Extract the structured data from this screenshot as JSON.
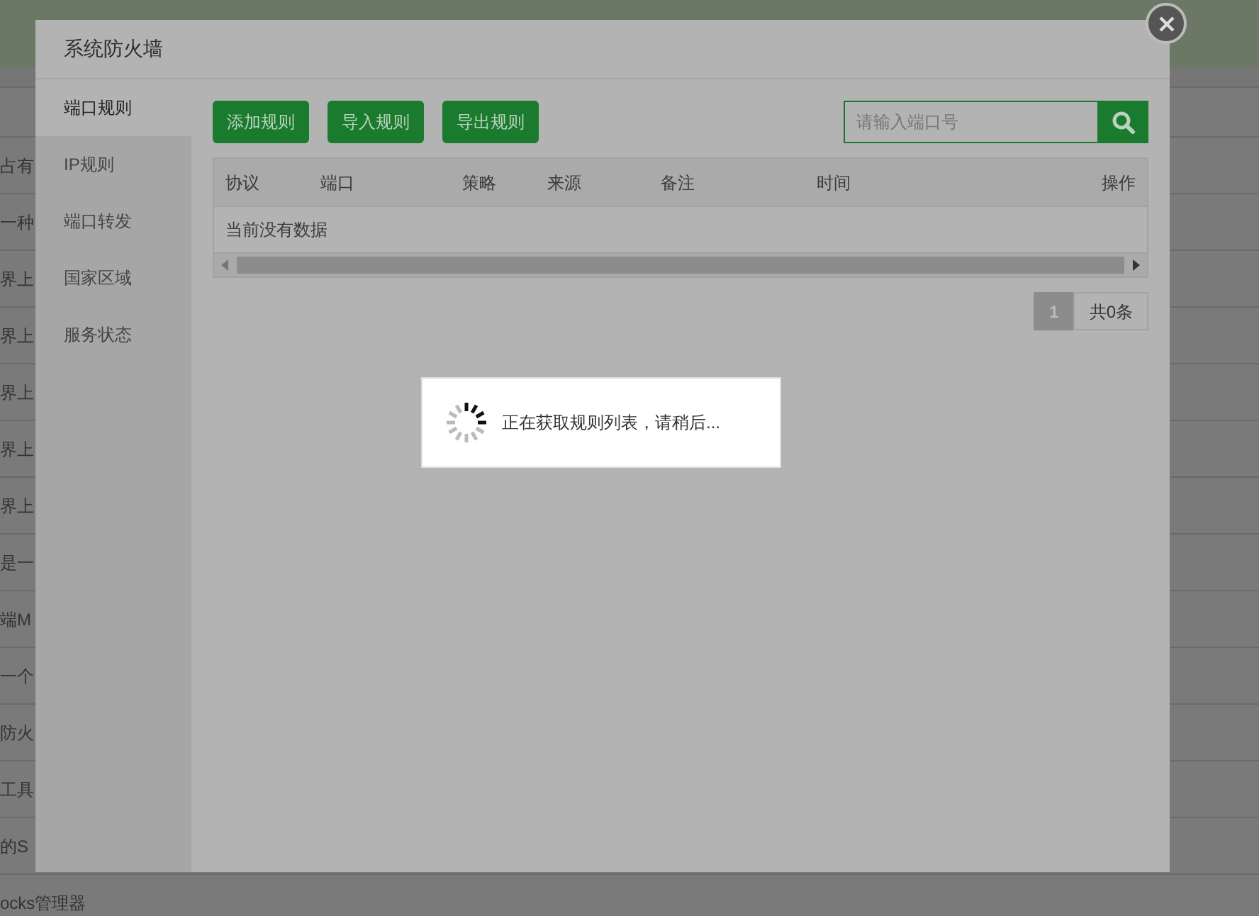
{
  "background_rows": [
    "占有",
    "一种",
    "界上",
    "界上",
    "界上",
    "界上",
    "界上",
    "是一",
    "端M",
    "一个",
    "防火",
    "工具",
    "的S",
    "ocks管理器"
  ],
  "dialog": {
    "title": "系统防火墙",
    "tabs": [
      {
        "label": "端口规则",
        "selected": true
      },
      {
        "label": "IP规则",
        "selected": false
      },
      {
        "label": "端口转发",
        "selected": false
      },
      {
        "label": "国家区域",
        "selected": false
      },
      {
        "label": "服务状态",
        "selected": false
      }
    ],
    "buttons": [
      "添加规则",
      "导入规则",
      "导出规则"
    ],
    "search": {
      "placeholder": "请输入端口号"
    },
    "table": {
      "columns": [
        "协议",
        "端口",
        "策略",
        "来源",
        "备注",
        "时间",
        "操作"
      ],
      "empty_text": "当前没有数据"
    },
    "pagination": {
      "pages": [
        {
          "label": "1",
          "selected": true
        }
      ],
      "total": "共0条"
    }
  },
  "loading": {
    "message": "正在获取规则列表，请稍后..."
  }
}
